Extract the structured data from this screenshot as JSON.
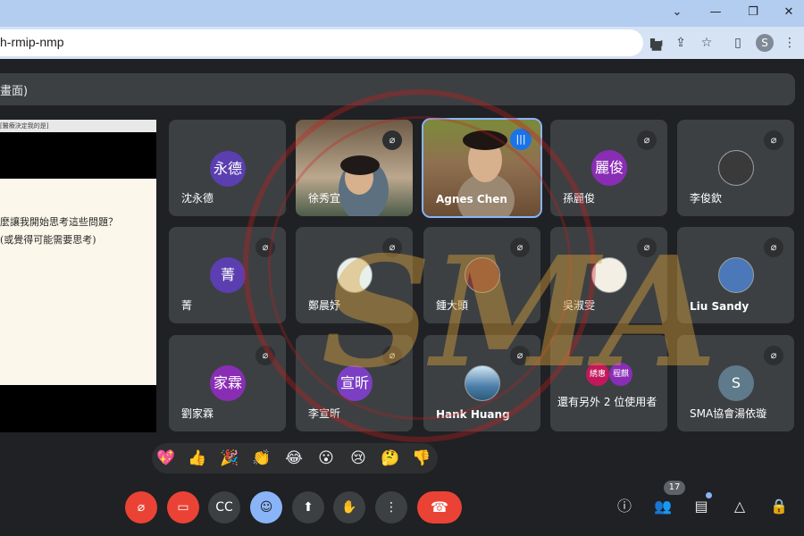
{
  "browser": {
    "url": "h-rmip-nmp",
    "profile_initial": "S",
    "window_controls": [
      "chevron-down-icon",
      "minimize-icon",
      "restore-icon",
      "close-icon"
    ]
  },
  "meeting": {
    "title": "畫面)"
  },
  "presentation": {
    "header": "[醫療決定我的是]",
    "lines": [
      "麼讓我開始思考這些問題？",
      "(或覺得可能需要思考)"
    ]
  },
  "tiles": [
    {
      "name": "沈永德",
      "avatar_text": "永德",
      "avatar_color": "#5b3fb0",
      "muted": true
    },
    {
      "name": "徐秀宜",
      "muted": true,
      "video": true
    },
    {
      "name": "Agnes Chen",
      "speaking": true,
      "video": true
    },
    {
      "name": "孫麗俊",
      "avatar_text": "麗俊",
      "avatar_color": "#8a2db5",
      "muted": true
    },
    {
      "name": "李俊欽",
      "muted": true,
      "photo": true
    },
    {
      "name": "菁",
      "avatar_text": "菁",
      "avatar_color": "#5b3fb0",
      "muted": true
    },
    {
      "name": "鄭晨妤",
      "muted": true,
      "photo": true
    },
    {
      "name": "鍾大頭",
      "muted": true,
      "photo": true
    },
    {
      "name": "吳淑雯",
      "muted": true,
      "photo": true
    },
    {
      "name": "Liu Sandy",
      "muted": true,
      "photo": true
    },
    {
      "name": "劉家霖",
      "avatar_text": "家霖",
      "avatar_color": "#8a2db5",
      "muted": true
    },
    {
      "name": "李宣昕",
      "avatar_text": "宣昕",
      "avatar_color": "#7b3fc4",
      "muted": true
    },
    {
      "name": "Hank Huang",
      "muted": true,
      "photo": true
    },
    {
      "name": "還有另外 2 位使用者",
      "others": [
        "綉惠",
        "程麒"
      ]
    },
    {
      "name": "SMA協會湯依璇",
      "avatar_text": "S",
      "avatar_color": "#5f7a8a",
      "muted": true
    }
  ],
  "reactions": [
    "💖",
    "👍",
    "🎉",
    "👏",
    "😂",
    "😮",
    "😢",
    "🤔",
    "👎"
  ],
  "controls": {
    "participant_count": "17"
  },
  "watermark": {
    "text": "SMA"
  }
}
